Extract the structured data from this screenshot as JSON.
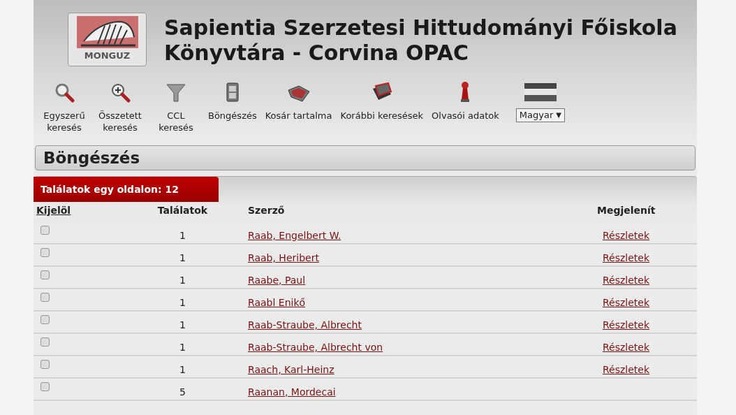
{
  "header": {
    "logo_text": "MONGUZ",
    "title_lines": [
      "Sapientia Szerzetesi Hittudományi Főiskola",
      "Könyvtára - Corvina OPAC"
    ]
  },
  "toolbar": [
    {
      "kind": "search",
      "label_lines": [
        "Egyszerű",
        "keresés"
      ]
    },
    {
      "kind": "zoom",
      "label_lines": [
        "Összetett",
        "keresés"
      ]
    },
    {
      "kind": "funnel",
      "label_lines": [
        "CCL",
        "keresés"
      ]
    },
    {
      "kind": "drawer",
      "label_lines": [
        "Böngészés"
      ]
    },
    {
      "kind": "basket",
      "label_lines": [
        "Kosár tartalma"
      ]
    },
    {
      "kind": "book",
      "label_lines": [
        "Korábbi keresések"
      ]
    },
    {
      "kind": "pawn",
      "label_lines": [
        "Olvasói adatok"
      ]
    },
    {
      "kind": "language",
      "value": "Magyar",
      "caret": "▼"
    }
  ],
  "page_title": "Böngészés",
  "results_tab": "Találatok egy oldalon: 12",
  "table": {
    "columns": [
      "Kijelöl",
      "Találatok",
      "Szerző",
      "Megjelenít"
    ],
    "rows": [
      {
        "checked": false,
        "count": "1",
        "author": "Raab, Engelbert W.",
        "details": "Részletek"
      },
      {
        "checked": false,
        "count": "1",
        "author": "Raab, Heribert",
        "details": "Részletek"
      },
      {
        "checked": false,
        "count": "1",
        "author": "Raabe, Paul",
        "details": "Részletek"
      },
      {
        "checked": false,
        "count": "1",
        "author": "Raabl Enikő",
        "details": "Részletek"
      },
      {
        "checked": false,
        "count": "1",
        "author": "Raab-Straube, Albrecht",
        "details": "Részletek"
      },
      {
        "checked": false,
        "count": "1",
        "author": "Raab-Straube, Albrecht von",
        "details": "Részletek"
      },
      {
        "checked": false,
        "count": "1",
        "author": "Raach, Karl-Heinz",
        "details": "Részletek"
      },
      {
        "checked": false,
        "count": "5",
        "author": "Raanan, Mordecai"
      }
    ]
  }
}
